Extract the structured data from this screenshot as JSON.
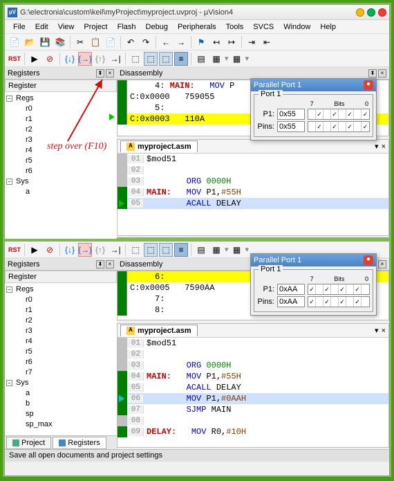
{
  "title": "G:\\electronia\\custom\\keil\\myProject\\myproject.uvproj - µVision4",
  "menus": [
    "File",
    "Edit",
    "View",
    "Project",
    "Flash",
    "Debug",
    "Peripherals",
    "Tools",
    "SVCS",
    "Window",
    "Help"
  ],
  "callout": "step over (F10)",
  "panels": {
    "registers": "Registers",
    "disassembly": "Disassembly",
    "reg_click": "Register"
  },
  "regs_top": {
    "group": "Regs",
    "items": [
      "r0",
      "r1",
      "r2",
      "r3",
      "r4",
      "r5",
      "r6"
    ],
    "sys": "Sys",
    "sys_items": [
      "a"
    ]
  },
  "regs_bot": {
    "group": "Regs",
    "items": [
      "r0",
      "r1",
      "r2",
      "r3",
      "r4",
      "r5",
      "r6",
      "r7"
    ],
    "sys": "Sys",
    "sys_items": [
      "a",
      "b",
      "sp",
      "sp_max"
    ]
  },
  "disasm_top": [
    {
      "addr": "     4:",
      "label": "MAIN:",
      "inst": "MOV",
      "arg": "P"
    },
    {
      "addr": "C:0x0000",
      "op": "759055"
    },
    {
      "addr": "     5:"
    },
    {
      "addr": "C:0x0003",
      "op": "110A",
      "hl": true,
      "arrow": true
    }
  ],
  "disasm_bot": [
    {
      "addr": "     6:",
      "hl": true
    },
    {
      "addr": "C:0x0005",
      "op": "7590AA"
    },
    {
      "addr": "     7:"
    },
    {
      "addr": "     8:"
    }
  ],
  "editor": {
    "filename": "myproject.asm",
    "top_lines": [
      {
        "n": "01",
        "text": "$mod51",
        "gut": "gray"
      },
      {
        "n": "02",
        "text": "",
        "gut": "gray"
      },
      {
        "n": "03",
        "org": "ORG",
        "addr": "0000H",
        "gut": "gray"
      },
      {
        "n": "04",
        "label": "MAIN:",
        "inst": "MOV",
        "arg": "P1,",
        "imm": "#55H",
        "gut": "green"
      },
      {
        "n": "05",
        "inst": "ACALL",
        "arg": "DELAY",
        "gut": "green",
        "arrow": true,
        "hl": true
      }
    ],
    "bot_lines": [
      {
        "n": "01",
        "text": "$mod51",
        "gut": "gray"
      },
      {
        "n": "02",
        "text": "",
        "gut": "gray"
      },
      {
        "n": "03",
        "org": "ORG",
        "addr": "0000H",
        "gut": "gray"
      },
      {
        "n": "04",
        "label": "MAIN:",
        "inst": "MOV",
        "arg": "P1,",
        "imm": "#55H",
        "gut": "green"
      },
      {
        "n": "05",
        "inst": "ACALL",
        "arg": "DELAY",
        "gut": "green"
      },
      {
        "n": "06",
        "inst": "MOV",
        "arg": "P1,",
        "imm": "#0AAH",
        "gut": "green",
        "arrow": "cyan",
        "hl": true
      },
      {
        "n": "07",
        "inst": "SJMP",
        "arg": "MAIN",
        "gut": "green"
      },
      {
        "n": "08",
        "text": "",
        "gut": "gray"
      },
      {
        "n": "09",
        "label": "DELAY:",
        "inst": "MOV",
        "arg": "R0,",
        "imm": "#10H",
        "gut": "green",
        "cut": true
      }
    ]
  },
  "port": {
    "title": "Parallel Port 1",
    "legend": "Port 1",
    "p1_label": "P1:",
    "pins_label": "Pins:",
    "bits_label": "Bits",
    "top": {
      "p1": "0x55",
      "pins": "0x55",
      "bits": [
        "",
        "✓",
        "",
        "✓",
        "",
        "✓",
        "",
        "✓"
      ]
    },
    "bot": {
      "p1": "0xAA",
      "pins": "0xAA",
      "bits": [
        "✓",
        "",
        "✓",
        "",
        "✓",
        "",
        "✓",
        ""
      ]
    }
  },
  "bottom_tabs": {
    "project": "Project",
    "registers": "Registers"
  },
  "status": "Save all open documents and project settings"
}
